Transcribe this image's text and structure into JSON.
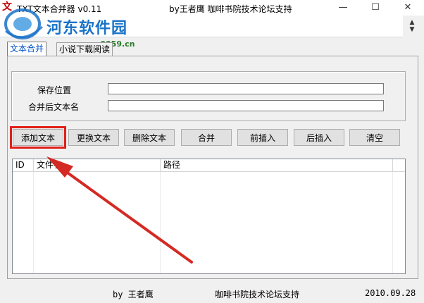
{
  "window": {
    "title": "TXT文本合并器 v0.11",
    "subtitle": "by王者鹰 咖啡书院技术论坛支持",
    "icon_glyph": "文",
    "controls": {
      "minimize": "—",
      "maximize": "☐",
      "close": "✕"
    }
  },
  "watermark": {
    "text": "河东软件园",
    "url": "www.pc0359.cn",
    "color": "#1a73c8"
  },
  "tabs": [
    {
      "label": "文本合并",
      "active": true
    },
    {
      "label": "小说下载阅读",
      "active": false
    }
  ],
  "form": {
    "save_location_label": "保存位置",
    "save_location_value": "",
    "merged_name_label": "合并后文本名",
    "merged_name_value": ""
  },
  "buttons": {
    "add": "添加文本",
    "replace": "更换文本",
    "delete": "删除文本",
    "merge": "合并",
    "insert_before": "前插入",
    "insert_after": "后插入",
    "clear": "清空"
  },
  "list": {
    "columns": [
      "ID",
      "文件名",
      "路径"
    ],
    "rows": []
  },
  "status": {
    "author": "by 王者鹰",
    "support": "咖啡书院技术论坛支持",
    "date": "2010.09.28"
  },
  "colors": {
    "highlight_box": "#e0201a",
    "arrow": "#d42a24",
    "active_tab_text": "#0050c8"
  },
  "icons": {
    "spin": "updown-spinner-icon",
    "arrow": "annotation-arrow"
  }
}
